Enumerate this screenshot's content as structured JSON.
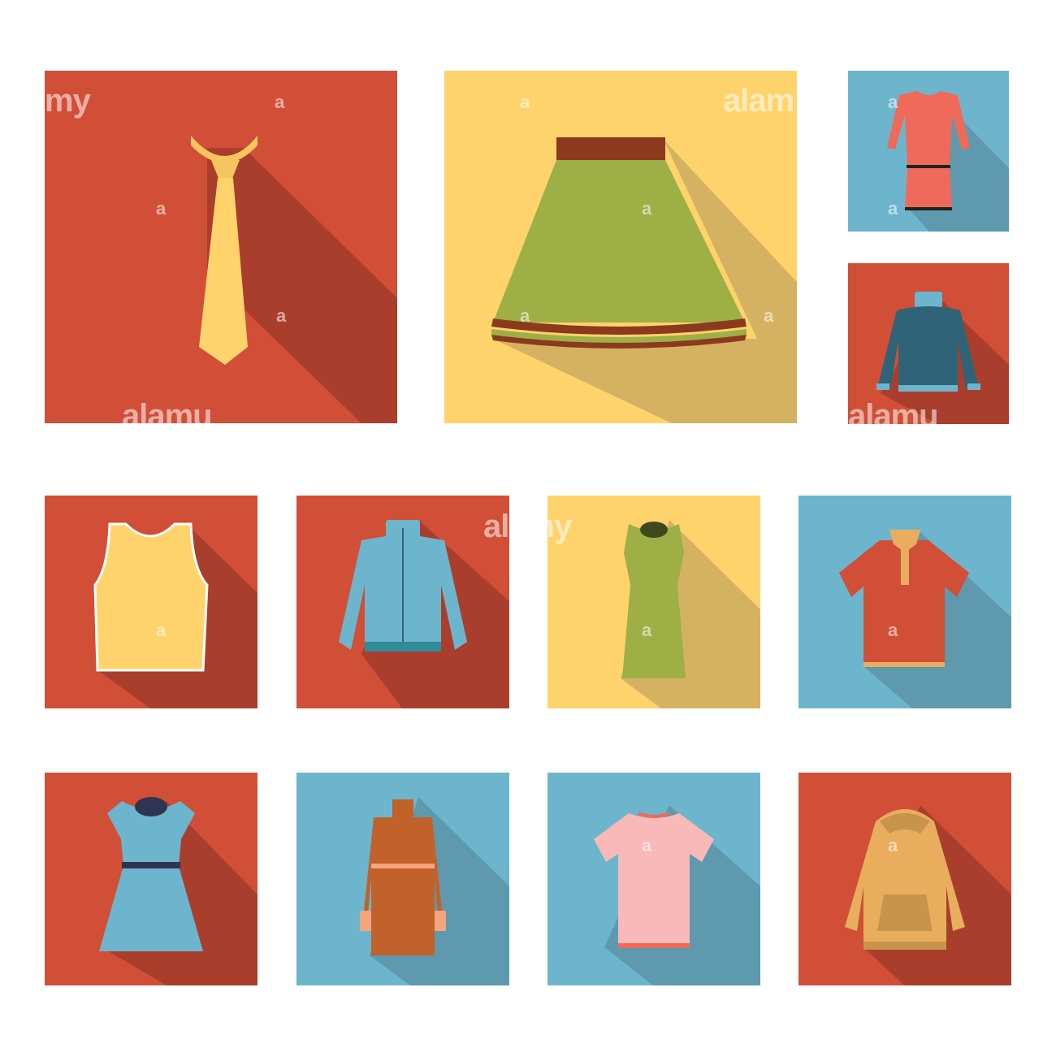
{
  "colors": {
    "red": "#D14F37",
    "yellow": "#FFD36C",
    "blue": "#6DB5CD",
    "shadow_red": "#AA3E2D",
    "shadow_yellow": "#D5B262",
    "shadow_blue": "#5E99AD"
  },
  "tiles": [
    {
      "icon": "tie-icon",
      "bg": "red"
    },
    {
      "icon": "skirt-icon",
      "bg": "yellow"
    },
    {
      "icon": "dress-long-sleeve-icon",
      "bg": "blue"
    },
    {
      "icon": "sweater-icon",
      "bg": "red"
    },
    {
      "icon": "tank-top-icon",
      "bg": "red"
    },
    {
      "icon": "zip-jacket-icon",
      "bg": "red"
    },
    {
      "icon": "sleeveless-dress-icon",
      "bg": "yellow"
    },
    {
      "icon": "polo-shirt-icon",
      "bg": "blue"
    },
    {
      "icon": "sundress-icon",
      "bg": "red"
    },
    {
      "icon": "coat-icon",
      "bg": "blue"
    },
    {
      "icon": "t-shirt-icon",
      "bg": "blue"
    },
    {
      "icon": "hoodie-icon",
      "bg": "red"
    }
  ],
  "watermarks": {
    "alamy": "alamy",
    "alamu": "alamu",
    "alam": "alam",
    "my": "my",
    "a": "a"
  }
}
